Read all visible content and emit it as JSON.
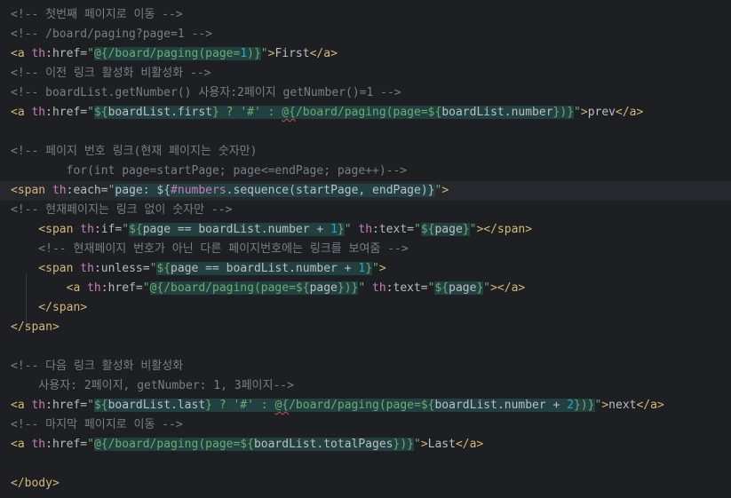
{
  "colors": {
    "background": "#1e1f22",
    "comment": "#7a7e85",
    "tag": "#d5b778",
    "string": "#6aab73",
    "text": "#bcbec4",
    "number": "#2aacb8",
    "expression_bg": "#22403f"
  },
  "lines": [
    {
      "tokens": [
        {
          "t": "<!-- 첫번째 페이지로 이동 -->",
          "c": "comment"
        }
      ]
    },
    {
      "tokens": [
        {
          "t": "<!-- /board/paging?page=1 -->",
          "c": "comment"
        }
      ]
    },
    {
      "tokens": [
        {
          "t": "<a ",
          "c": "tag"
        },
        {
          "t": "th",
          "c": "ns"
        },
        {
          "t": ":href=",
          "c": "attr"
        },
        {
          "t": "\"",
          "c": "str"
        },
        {
          "t": "@{/board/paging(page=",
          "c": "str",
          "e": 1
        },
        {
          "t": "1",
          "c": "num",
          "e": 1
        },
        {
          "t": ")}",
          "c": "str",
          "e": 1
        },
        {
          "t": "\"",
          "c": "str"
        },
        {
          "t": ">",
          "c": "tag"
        },
        {
          "t": "First",
          "c": "text"
        },
        {
          "t": "</a>",
          "c": "tag"
        }
      ]
    },
    {
      "tokens": [
        {
          "t": "<!-- 이전 링크 활성화 비활성화 -->",
          "c": "comment"
        }
      ]
    },
    {
      "tokens": [
        {
          "t": "<!-- boardList.getNumber() 사용자:2페이지 getNumber()=1 -->",
          "c": "comment"
        }
      ]
    },
    {
      "tokens": [
        {
          "t": "<a ",
          "c": "tag"
        },
        {
          "t": "th",
          "c": "ns"
        },
        {
          "t": ":href=",
          "c": "attr"
        },
        {
          "t": "\"",
          "c": "str"
        },
        {
          "t": "${",
          "c": "str",
          "e": 1
        },
        {
          "t": "boardList.first",
          "c": "text",
          "e": 1
        },
        {
          "t": "} ? ",
          "c": "str",
          "e": 1
        },
        {
          "t": "'#'",
          "c": "str",
          "e": 1
        },
        {
          "t": " : ",
          "c": "str",
          "e": 1
        },
        {
          "t": "@{",
          "c": "str",
          "e": 1,
          "w": 1
        },
        {
          "t": "/board/paging(page=${",
          "c": "str",
          "e": 1
        },
        {
          "t": "boardList.number",
          "c": "text",
          "e": 1
        },
        {
          "t": "})}",
          "c": "str",
          "e": 1
        },
        {
          "t": "\"",
          "c": "str"
        },
        {
          "t": ">",
          "c": "tag"
        },
        {
          "t": "prev",
          "c": "text"
        },
        {
          "t": "</a>",
          "c": "tag"
        }
      ]
    },
    {
      "tokens": []
    },
    {
      "tokens": [
        {
          "t": "<!-- 페이지 번호 링크(현재 페이지는 숫자만)",
          "c": "comment"
        }
      ]
    },
    {
      "tokens": [
        {
          "t": "        for(int page=startPage; page<=endPage; page++)-->",
          "c": "comment"
        }
      ]
    },
    {
      "hl": 1,
      "tokens": [
        {
          "t": "<span ",
          "c": "tag"
        },
        {
          "t": "th",
          "c": "ns"
        },
        {
          "t": ":each=",
          "c": "attr"
        },
        {
          "t": "\"",
          "c": "str"
        },
        {
          "t": "page: ${",
          "c": "text",
          "e": 1
        },
        {
          "t": "#numbers",
          "c": "var",
          "e": 1
        },
        {
          "t": ".",
          "c": "text",
          "e": 1
        },
        {
          "t": "sequence",
          "c": "text",
          "e": 1
        },
        {
          "t": "(startPage, endPage)}",
          "c": "text",
          "e": 1
        },
        {
          "t": "\"",
          "c": "str"
        },
        {
          "t": ">",
          "c": "tag"
        }
      ]
    },
    {
      "tokens": [
        {
          "t": "<!-- 현재페이지는 링크 없이 숫자만 -->",
          "c": "comment"
        }
      ]
    },
    {
      "tokens": [
        {
          "t": "    <span ",
          "c": "tag"
        },
        {
          "t": "th",
          "c": "ns"
        },
        {
          "t": ":if=",
          "c": "attr"
        },
        {
          "t": "\"",
          "c": "str"
        },
        {
          "t": "${",
          "c": "str",
          "e": 1
        },
        {
          "t": "page == boardList.number + ",
          "c": "text",
          "e": 1
        },
        {
          "t": "1",
          "c": "num",
          "e": 1
        },
        {
          "t": "}",
          "c": "str",
          "e": 1
        },
        {
          "t": "\" ",
          "c": "str"
        },
        {
          "t": "th",
          "c": "ns"
        },
        {
          "t": ":text=",
          "c": "attr"
        },
        {
          "t": "\"",
          "c": "str"
        },
        {
          "t": "${",
          "c": "str",
          "e": 1
        },
        {
          "t": "page",
          "c": "text",
          "e": 1
        },
        {
          "t": "}",
          "c": "str",
          "e": 1
        },
        {
          "t": "\"",
          "c": "str"
        },
        {
          "t": "></span>",
          "c": "tag"
        }
      ]
    },
    {
      "tokens": [
        {
          "t": "    <!-- 현재페이지 번호가 아닌 다른 페이지번호에는 링크를 보여줌 -->",
          "c": "comment"
        }
      ]
    },
    {
      "tokens": [
        {
          "t": "    <span ",
          "c": "tag"
        },
        {
          "t": "th",
          "c": "ns"
        },
        {
          "t": ":unless=",
          "c": "attr"
        },
        {
          "t": "\"",
          "c": "str"
        },
        {
          "t": "${",
          "c": "str",
          "e": 1
        },
        {
          "t": "page == boardList.number + ",
          "c": "text",
          "e": 1
        },
        {
          "t": "1",
          "c": "num",
          "e": 1
        },
        {
          "t": "}",
          "c": "str",
          "e": 1
        },
        {
          "t": "\"",
          "c": "str"
        },
        {
          "t": ">",
          "c": "tag"
        }
      ]
    },
    {
      "tokens": [
        {
          "t": "        <a ",
          "c": "tag"
        },
        {
          "t": "th",
          "c": "ns"
        },
        {
          "t": ":href=",
          "c": "attr"
        },
        {
          "t": "\"",
          "c": "str"
        },
        {
          "t": "@{/board/paging(page=${",
          "c": "str",
          "e": 1
        },
        {
          "t": "page",
          "c": "text",
          "e": 1
        },
        {
          "t": "})}",
          "c": "str",
          "e": 1
        },
        {
          "t": "\" ",
          "c": "str"
        },
        {
          "t": "th",
          "c": "ns"
        },
        {
          "t": ":text=",
          "c": "attr"
        },
        {
          "t": "\"",
          "c": "str"
        },
        {
          "t": "${",
          "c": "str",
          "e": 1
        },
        {
          "t": "page",
          "c": "text",
          "e": 1
        },
        {
          "t": "}",
          "c": "str",
          "e": 1
        },
        {
          "t": "\"",
          "c": "str"
        },
        {
          "t": "></a>",
          "c": "tag"
        }
      ]
    },
    {
      "tokens": [
        {
          "t": "    </span>",
          "c": "tag"
        }
      ]
    },
    {
      "tokens": [
        {
          "t": "</span>",
          "c": "tag"
        }
      ]
    },
    {
      "tokens": []
    },
    {
      "tokens": [
        {
          "t": "<!-- 다음 링크 활성화 비활성화",
          "c": "comment"
        }
      ]
    },
    {
      "tokens": [
        {
          "t": "    사용자: 2페이지, getNumber: 1, 3페이지-->",
          "c": "comment"
        }
      ]
    },
    {
      "tokens": [
        {
          "t": "<a ",
          "c": "tag"
        },
        {
          "t": "th",
          "c": "ns"
        },
        {
          "t": ":href=",
          "c": "attr"
        },
        {
          "t": "\"",
          "c": "str"
        },
        {
          "t": "${",
          "c": "str",
          "e": 1
        },
        {
          "t": "boardList.last",
          "c": "text",
          "e": 1
        },
        {
          "t": "} ? ",
          "c": "str",
          "e": 1
        },
        {
          "t": "'#'",
          "c": "str",
          "e": 1
        },
        {
          "t": " : ",
          "c": "str",
          "e": 1
        },
        {
          "t": "@{",
          "c": "str",
          "e": 1,
          "w": 1
        },
        {
          "t": "/board/paging(page=${",
          "c": "str",
          "e": 1
        },
        {
          "t": "boardList.number + ",
          "c": "text",
          "e": 1
        },
        {
          "t": "2",
          "c": "num",
          "e": 1
        },
        {
          "t": "})}",
          "c": "str",
          "e": 1
        },
        {
          "t": "\"",
          "c": "str"
        },
        {
          "t": ">",
          "c": "tag"
        },
        {
          "t": "next",
          "c": "text"
        },
        {
          "t": "</a>",
          "c": "tag"
        }
      ]
    },
    {
      "tokens": [
        {
          "t": "<!-- 마지막 페이지로 이동 -->",
          "c": "comment"
        }
      ]
    },
    {
      "tokens": [
        {
          "t": "<a ",
          "c": "tag"
        },
        {
          "t": "th",
          "c": "ns"
        },
        {
          "t": ":href=",
          "c": "attr"
        },
        {
          "t": "\"",
          "c": "str"
        },
        {
          "t": "@{/board/paging(page=${",
          "c": "str",
          "e": 1
        },
        {
          "t": "boardList.totalPages",
          "c": "text",
          "e": 1
        },
        {
          "t": "})}",
          "c": "str",
          "e": 1
        },
        {
          "t": "\"",
          "c": "str"
        },
        {
          "t": ">",
          "c": "tag"
        },
        {
          "t": "Last",
          "c": "text"
        },
        {
          "t": "</a>",
          "c": "tag"
        }
      ]
    },
    {
      "tokens": []
    },
    {
      "tokens": [
        {
          "t": "</body>",
          "c": "tag"
        }
      ]
    }
  ]
}
